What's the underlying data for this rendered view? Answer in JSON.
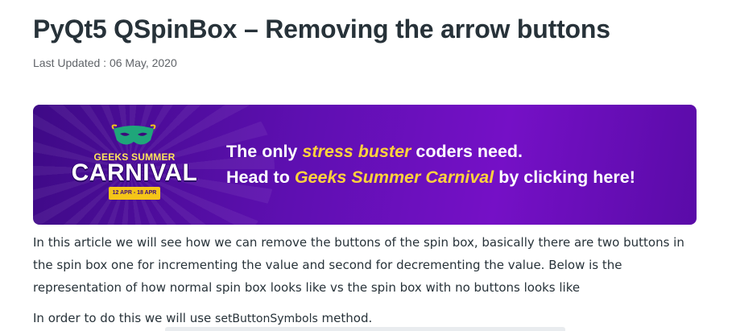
{
  "article": {
    "title": "PyQt5 QSpinBox – Removing the arrow buttons",
    "last_updated": "Last Updated : 06 May, 2020"
  },
  "banner": {
    "logo_top": "GEEKS SUMMER",
    "logo_main": "CARNIVAL",
    "logo_dates": "12 APR - 18 APR",
    "line1_pre": "The only ",
    "line1_highlight": "stress buster",
    "line1_post": " coders need.",
    "line2_pre": "Head to ",
    "line2_highlight": "Geeks Summer Carnival",
    "line2_post": " by clicking here!",
    "highlight_color": "#ffd23c"
  },
  "body": {
    "paragraph1": "In this article we will see how we can remove the buttons of the spin box, basically there are two buttons in the spin box one for incrementing the value and second for decrementing the value. Below is the representation of how normal spin box looks like vs the spin box with no buttons looks like",
    "paragraph2_pre": "In order to do this we will use ",
    "paragraph2_code": "setButtonSymbols",
    "paragraph2_post": " method."
  }
}
